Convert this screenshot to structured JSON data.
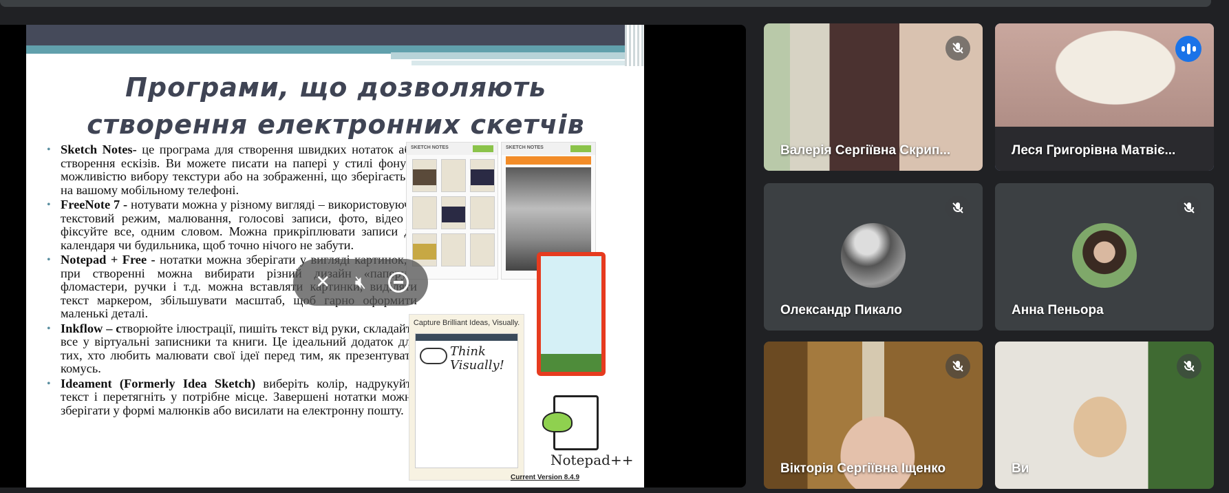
{
  "slide": {
    "title_line1": "Програми, що дозволяють",
    "title_line2": "створення електронних скетчів",
    "bullets": [
      {
        "name": "Sketch Notes-",
        "text": " це програма для створення швидких нотаток або створення ескізів. Ви можете писати на папері у стилі фону з можливістю вибору текстури або на зображенні, що зберігається на вашому мобільному телефоні."
      },
      {
        "name": "FreeNote 7 -",
        "text": " нотувати можна у різному вигляді – використовуючи текстовий режим, малювання, голосові записи, фото, відео – фіксуйте все, одним словом. Можна прикріплювати записи до календаря чи будильника, щоб точно нічого не забути."
      },
      {
        "name": "Notepad + Free -",
        "text": " нотатки можна зберігати у вигляді картинок, а при створенні можна вибирати різний дизайн «паперу», фломастери, ручки і т.д. можна вставляти картинки, виділяти текст маркером, збільшувати масштаб, щоб гарно оформити маленькі деталі."
      },
      {
        "name": "Inkflow – c",
        "text": "творюйте ілюстрації, пишіть текст від руки, складайте все у віртуальні записники та книги. Це ідеальний додаток для тих, хто любить малювати свої ідеї перед тим, як презентувати комусь."
      },
      {
        "name": "Ideament (Formerly Idea Sketch)",
        "text": " виберіть колір, надрукуйте текст і перетягніть у потрібне місце. Завершені нотатки можна зберігати у формі малюнків або висилати на електронну пошту."
      }
    ],
    "app1_header": "SKETCH NOTES",
    "app2_header": "SKETCH NOTES",
    "card_caption": "Capture Brilliant Ideas, Visually.",
    "card_think": "Think Visually!",
    "notepad_word": "Notepad++",
    "version": "Current Version 8.4.9"
  },
  "participants": [
    {
      "name": "Валерія Сергіївна Скрип...",
      "muted": true,
      "speaking": false,
      "icon": "mic-off-icon"
    },
    {
      "name": "Леся Григорівна Матвіє...",
      "muted": false,
      "speaking": true,
      "icon": "speaking-indicator-icon"
    },
    {
      "name": "Олександр Пикало",
      "muted": true,
      "speaking": false,
      "icon": "mic-off-icon"
    },
    {
      "name": "Анна Пеньора",
      "muted": true,
      "speaking": false,
      "icon": "mic-off-icon"
    },
    {
      "name": "Вікторія Сергіївна Іщенко",
      "muted": true,
      "speaking": false,
      "icon": "mic-off-icon"
    },
    {
      "name": "Ви",
      "muted": true,
      "speaking": false,
      "icon": "mic-off-icon"
    }
  ],
  "colors": {
    "accent": "#1a73e8",
    "tile_bg": "#3c4043",
    "page_bg": "#202124"
  }
}
